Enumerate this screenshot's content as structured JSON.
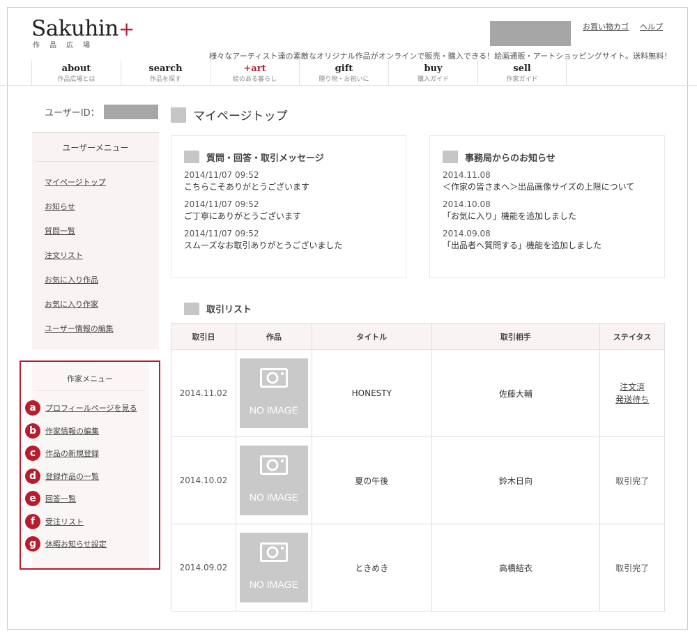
{
  "header": {
    "logo_main": "Sakuhin",
    "logo_plus": "+",
    "logo_sub": "作品広場",
    "links": [
      "お買い物カゴ",
      "ヘルプ"
    ],
    "tagline": "様々なアーティスト達の素敵なオリジナル作品がオンラインで販売・購入できる！絵画通販・アートショッピングサイト。送料無料！"
  },
  "nav": [
    {
      "title": "about",
      "sub": "作品広場とは"
    },
    {
      "title": "search",
      "sub": "作品を探す"
    },
    {
      "title": "+art",
      "sub": "絵のある暮らし"
    },
    {
      "title": "gift",
      "sub": "贈り物・お祝いに"
    },
    {
      "title": "buy",
      "sub": "購入ガイド"
    },
    {
      "title": "sell",
      "sub": "作家ガイド"
    }
  ],
  "sidebar": {
    "user_id_label": "ユーザーID：",
    "user_menu_title": "ユーザーメニュー",
    "user_menu": [
      "マイページトップ",
      "お知らせ",
      "質問一覧",
      "注文リスト",
      "お気に入り作品",
      "お気に入り作家",
      "ユーザー情報の編集"
    ],
    "author_menu_title": "作家メニュー",
    "author_menu": [
      {
        "badge": "a",
        "label": "プロフィールページを見る"
      },
      {
        "badge": "b",
        "label": "作家情報の編集"
      },
      {
        "badge": "c",
        "label": "作品の新規登録"
      },
      {
        "badge": "d",
        "label": "登録作品の一覧"
      },
      {
        "badge": "e",
        "label": "回答一覧"
      },
      {
        "badge": "f",
        "label": "受注リスト"
      },
      {
        "badge": "g",
        "label": "休暇お知らせ設定"
      }
    ]
  },
  "main": {
    "page_title": "マイページトップ",
    "messages_panel": {
      "title": "質問・回答・取引メッセージ",
      "items": [
        {
          "date": "2014/11/07 09:52",
          "text": "こちらこそありがとうございます"
        },
        {
          "date": "2014/11/07 09:52",
          "text": "ご丁寧にありがとうございます"
        },
        {
          "date": "2014/11/07 09:52",
          "text": "スムーズなお取引ありがとうございました"
        }
      ]
    },
    "notice_panel": {
      "title": "事務局からのお知らせ",
      "items": [
        {
          "date": "2014.11.08",
          "text": "＜作家の皆さまへ＞出品画像サイズの上限について"
        },
        {
          "date": "2014.10.08",
          "text": "「お気に入り」機能を追加しました"
        },
        {
          "date": "2014.09.08",
          "text": "「出品者へ質問する」機能を追加しました"
        }
      ]
    },
    "trade_list": {
      "title": "取引リスト",
      "columns": [
        "取引日",
        "作品",
        "タイトル",
        "取引相手",
        "ステイタス"
      ],
      "no_image_label": "NO IMAGE",
      "rows": [
        {
          "date": "2014.11.02",
          "title": "HONESTY",
          "partner": "佐藤大輔",
          "status": [
            "注文済",
            "発送待ち"
          ],
          "status_link": true
        },
        {
          "date": "2014.10.02",
          "title": "夏の午後",
          "partner": "鈴木日向",
          "status": [
            "取引完了"
          ],
          "status_link": false
        },
        {
          "date": "2014.09.02",
          "title": "ときめき",
          "partner": "高橋結衣",
          "status": [
            "取引完了"
          ],
          "status_link": false
        }
      ]
    }
  },
  "colors": {
    "accent": "#b0243a",
    "highlight_border": "#b81d2e",
    "placeholder_gray": "#a6a6a6",
    "panel_bg": "#f9f3f3"
  }
}
